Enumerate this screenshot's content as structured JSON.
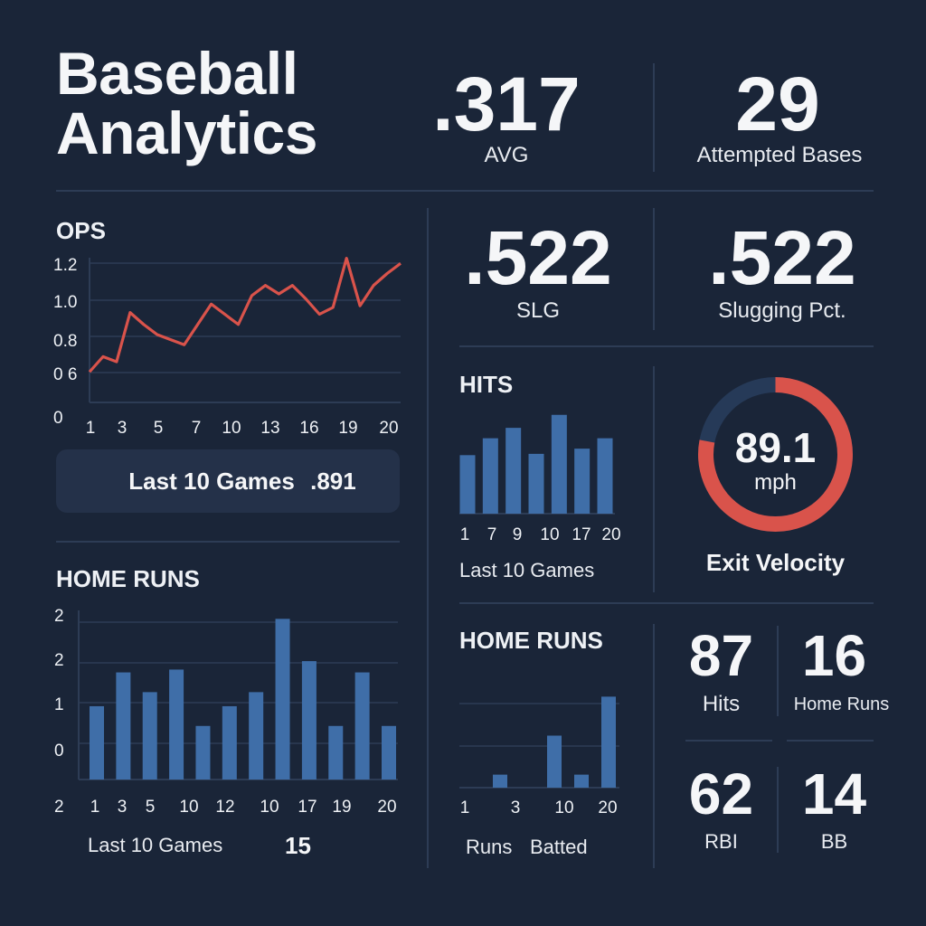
{
  "header": {
    "title_line1": "Baseball",
    "title_line2": "Analytics"
  },
  "stats": {
    "avg": {
      "value": ".317",
      "label": "AVG"
    },
    "attempted_bases": {
      "value": "29",
      "label": "Attempted Bases"
    },
    "slg": {
      "value": ".522",
      "label": "SLG"
    },
    "slugging_pct": {
      "value": ".522",
      "label": "Slugging Pct."
    },
    "hits": {
      "value": "87",
      "label": "Hits"
    },
    "home_runs": {
      "value": "16",
      "label": "Home Runs"
    },
    "rbi": {
      "value": "62",
      "label": "RBI"
    },
    "bb": {
      "value": "14",
      "label": "BB"
    }
  },
  "ops_panel": {
    "title": "OPS",
    "pill_label": "Last 10 Games",
    "pill_value": ".891"
  },
  "hr_left_panel": {
    "title": "HOME RUNS",
    "footer_label": "Last 10 Games",
    "footer_value": "15"
  },
  "hits_panel": {
    "title": "HITS",
    "footer_label": "Last 10 Games"
  },
  "hr_right_panel": {
    "title": "HOME RUNS",
    "footer_label_1": "Runs",
    "footer_label_2": "Batted"
  },
  "exit_velocity": {
    "value": "89.1",
    "unit": "mph",
    "label": "Exit Velocity",
    "fraction": 0.78
  },
  "colors": {
    "background": "#1a2538",
    "line": "#d9534b",
    "bar": "#3f6ea8",
    "gauge_track": "#263a58",
    "gridline": "#2d3c55"
  },
  "chart_data": [
    {
      "id": "ops",
      "type": "line",
      "title": "OPS",
      "x_tick_labels": [
        "1",
        "3",
        "5",
        "7",
        "10",
        "13",
        "16",
        "19",
        "20"
      ],
      "y_tick_labels": [
        "1.2",
        "1.0",
        "0.8",
        "0 6",
        "0"
      ],
      "ylim": [
        0.4,
        1.2
      ],
      "grid": true,
      "values": [
        0.58,
        0.67,
        0.64,
        0.93,
        0.86,
        0.8,
        0.77,
        0.74,
        0.86,
        0.98,
        0.92,
        0.86,
        1.03,
        1.09,
        1.04,
        1.09,
        1.01,
        0.92,
        0.96,
        1.25,
        0.97,
        1.09,
        1.16,
        1.22
      ]
    },
    {
      "id": "home-runs-left",
      "type": "bar",
      "title": "HOME RUNS",
      "x_tick_labels": [
        "1",
        "3",
        "5",
        "10",
        "12",
        "10",
        "17",
        "19",
        "20"
      ],
      "y_tick_labels": [
        "2",
        "2",
        "1",
        "0",
        "2"
      ],
      "ylim": [
        0,
        3
      ],
      "grid": true,
      "values": [
        1.3,
        1.9,
        1.55,
        1.95,
        0.95,
        1.3,
        1.55,
        2.85,
        2.1,
        0.95,
        1.9,
        0.95
      ]
    },
    {
      "id": "hits",
      "type": "bar",
      "title": "HITS",
      "x_tick_labels": [
        "1",
        "7",
        "9",
        "10",
        "17",
        "20"
      ],
      "ylim": [
        0,
        4
      ],
      "grid": false,
      "values": [
        2.25,
        2.9,
        3.3,
        2.3,
        3.8,
        2.5,
        2.9
      ]
    },
    {
      "id": "home-runs-right",
      "type": "bar",
      "title": "HOME RUNS",
      "x_tick_labels": [
        "1",
        "3",
        "10",
        "20"
      ],
      "ylim": [
        0,
        4
      ],
      "grid": true,
      "values": [
        0,
        0.5,
        0,
        2.0,
        0.5,
        3.5
      ]
    }
  ]
}
